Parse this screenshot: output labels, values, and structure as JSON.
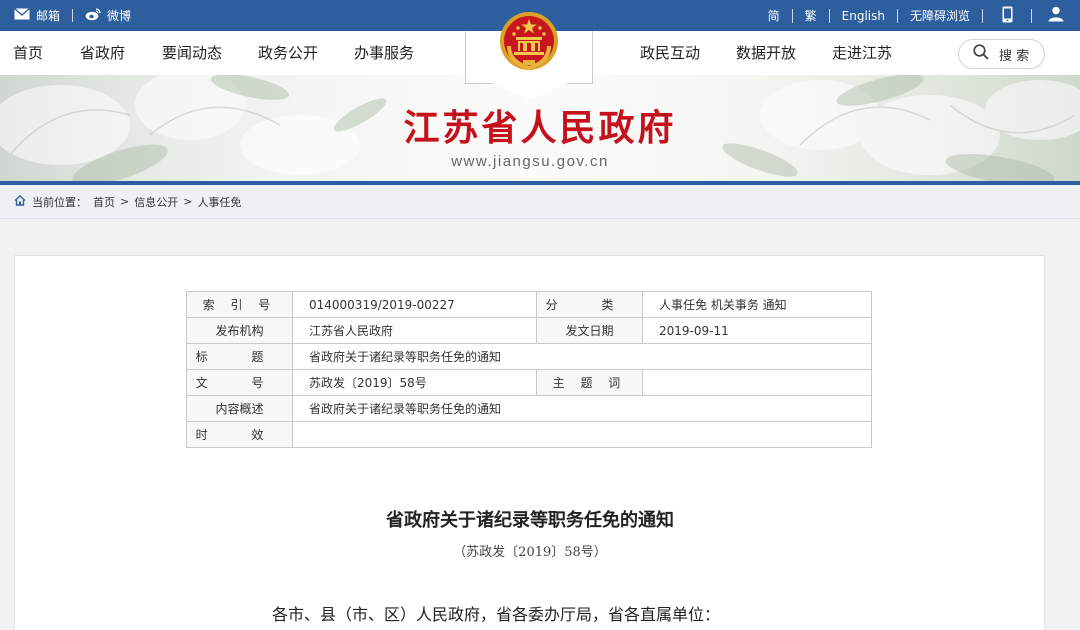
{
  "topbar": {
    "mail": "邮箱",
    "weibo": "微博",
    "links": [
      "简",
      "繁",
      "English",
      "无障碍浏览"
    ]
  },
  "nav": {
    "left": [
      "首页",
      "省政府",
      "要闻动态",
      "政务公开",
      "办事服务"
    ],
    "right": [
      "政民互动",
      "数据开放",
      "走进江苏"
    ],
    "search_label": "搜 索"
  },
  "banner": {
    "title": "江苏省人民政府",
    "url": "www.jiangsu.gov.cn"
  },
  "breadcrumb": {
    "label": "当前位置：",
    "items": [
      "首页",
      "信息公开",
      "人事任免"
    ]
  },
  "meta": {
    "index_label": "索 引 号",
    "index_value": "014000319/2019-00227",
    "category_label": "分 类",
    "category_value": "人事任免 机关事务 通知",
    "publisher_label": "发布机构",
    "publisher_value": "江苏省人民政府",
    "date_label": "发文日期",
    "date_value": "2019-09-11",
    "title_label": "标 题",
    "title_value": "省政府关于诸纪录等职务任免的通知",
    "docno_label": "文 号",
    "docno_value": "苏政发〔2019〕58号",
    "keywords_label": "主 题 词",
    "keywords_value": "",
    "summary_label": "内容概述",
    "summary_value": "省政府关于诸纪录等职务任免的通知",
    "validity_label": "时 效",
    "validity_value": ""
  },
  "document": {
    "title": "省政府关于诸纪录等职务任免的通知",
    "number": "（苏政发〔2019〕58号）",
    "salutation": "各市、县（市、区）人民政府，省各委办厅局，省各直属单位："
  },
  "colors": {
    "brand_blue": "#2d5f9e",
    "title_red": "#c4111c"
  }
}
